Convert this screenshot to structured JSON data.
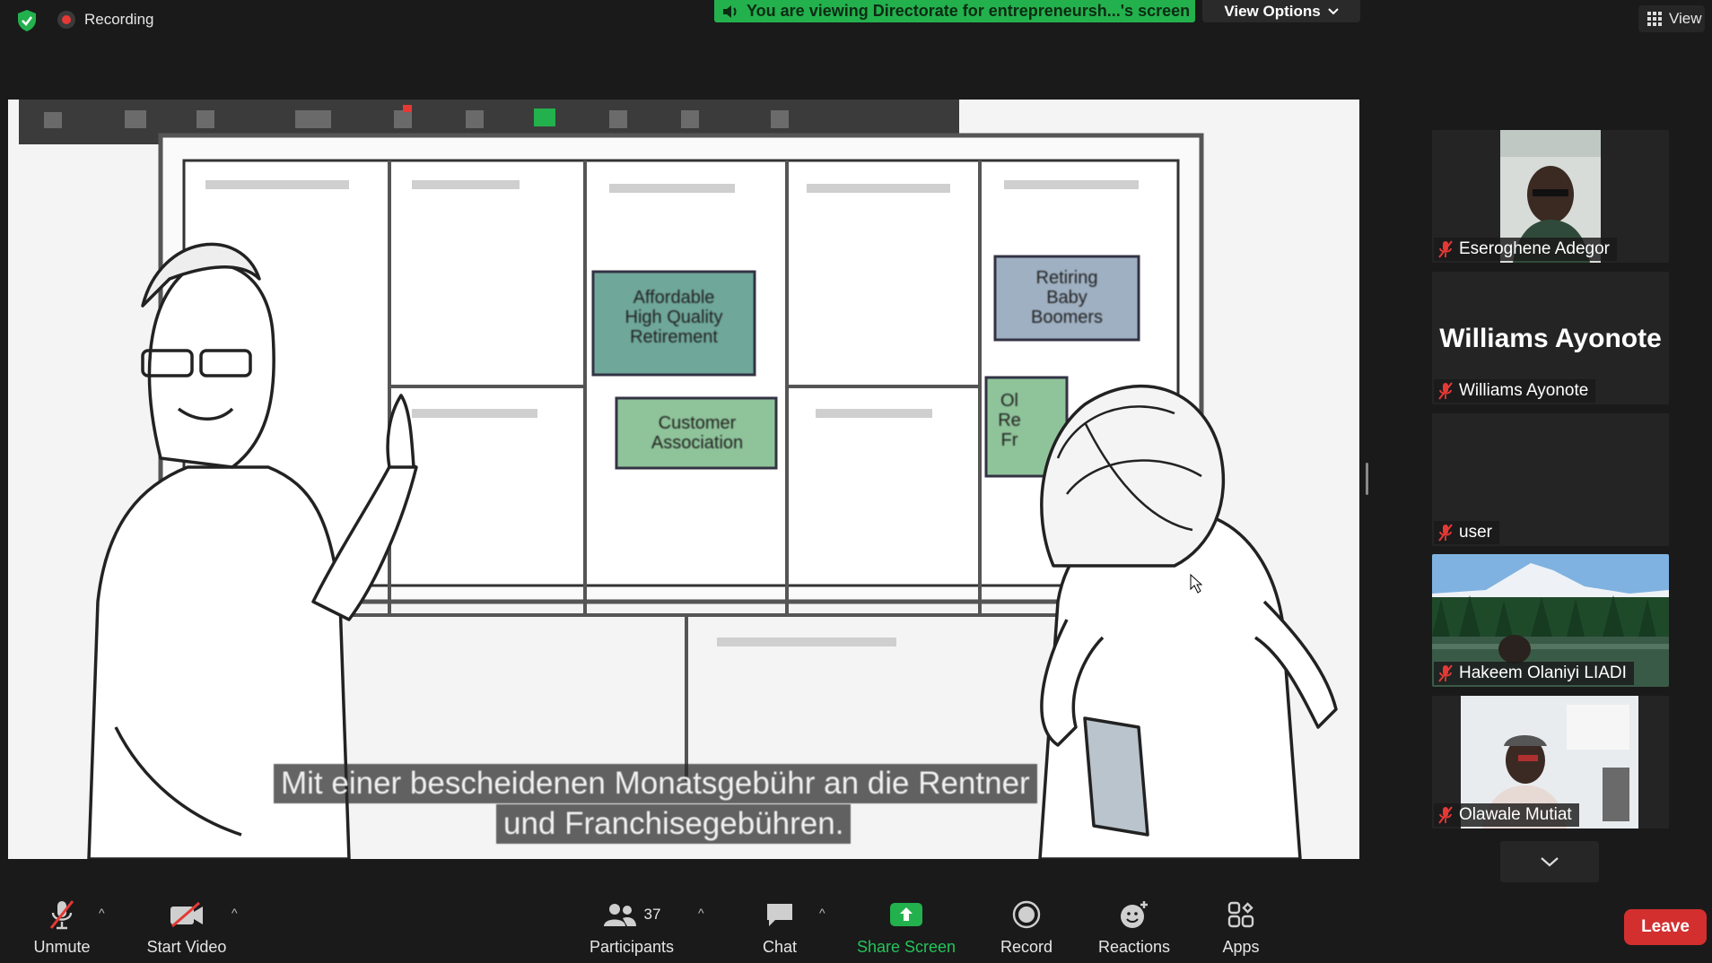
{
  "top_bar": {
    "recording_label": "Recording",
    "share_banner": "You are viewing Directorate for entrepreneursh...'s screen",
    "view_options_label": "View Options",
    "view_label": "View"
  },
  "shared_screen": {
    "subtitle_line1": "Mit einer bescheidenen Monatsgebühr an die Rentner",
    "subtitle_line2": "und Franchisegebühren.",
    "sticky_notes": [
      {
        "text": "Affordable\nHigh Quality\nRetirement",
        "color": "#6fa79a"
      },
      {
        "text": "Customer\nAssociation",
        "color": "#8fc49a"
      },
      {
        "text": "Retiring\nBaby\nBoomers",
        "color": "#9fb0c2"
      },
      {
        "text": "Ol\nRe\nFr",
        "color": "#8fc49a"
      }
    ]
  },
  "participants_panel": {
    "tiles": [
      {
        "name": "Eseroghene Adegor",
        "type": "video-person"
      },
      {
        "name": "Williams Ayonote",
        "display_name": "Williams Ayonote",
        "type": "name-only"
      },
      {
        "name": "user",
        "type": "blank"
      },
      {
        "name": "Hakeem Olaniyi LIADI",
        "type": "video-landscape"
      },
      {
        "name": "Olawale Mutiat",
        "type": "video-person"
      }
    ]
  },
  "toolbar": {
    "unmute_label": "Unmute",
    "start_video_label": "Start Video",
    "participants_label": "Participants",
    "participants_count": "37",
    "chat_label": "Chat",
    "share_screen_label": "Share Screen",
    "record_label": "Record",
    "reactions_label": "Reactions",
    "apps_label": "Apps",
    "leave_label": "Leave"
  },
  "colors": {
    "accent_green": "#23b14d",
    "leave_red": "#d32f2f",
    "mic_off_red": "#e53935",
    "background": "#1a1a1a"
  }
}
